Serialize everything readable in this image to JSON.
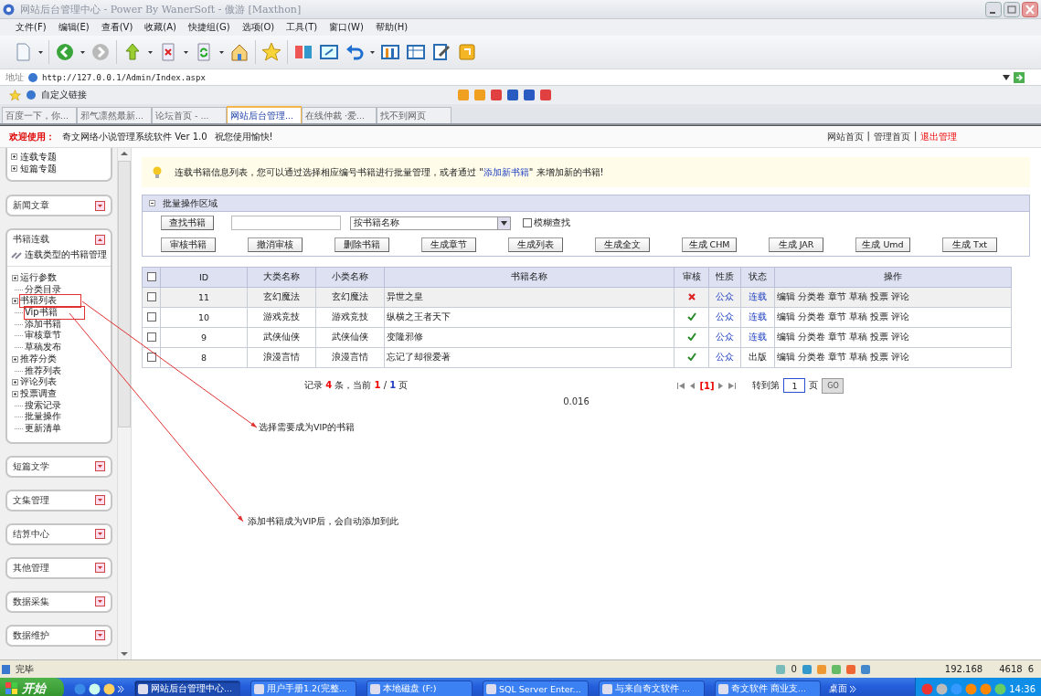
{
  "window": {
    "title": "网站后台管理中心 - Power By WanerSoft - 傲游 [Maxthon]"
  },
  "menu": [
    "文件(F)",
    "编辑(E)",
    "查看(V)",
    "收藏(A)",
    "快捷组(G)",
    "选项(O)",
    "工具(T)",
    "窗口(W)",
    "帮助(H)"
  ],
  "address_bar": {
    "label": "地址",
    "value": "http://127.0.0.1/Admin/Index.aspx"
  },
  "links_bar": {
    "items": [
      "自定义链接"
    ]
  },
  "browser_tabs": [
    {
      "label": "百度一下，你...",
      "selected": false
    },
    {
      "label": "邪气凛然最新...",
      "selected": false
    },
    {
      "label": "论坛首页 - ...",
      "selected": false
    },
    {
      "label": "网站后台管理...",
      "selected": true
    },
    {
      "label": "在线仲裁 ·爱...",
      "selected": false
    },
    {
      "label": "找不到网页",
      "selected": false
    }
  ],
  "app_header": {
    "welcome": "欢迎使用：",
    "product": "奇文网络小说管理系统软件  Ver 1.0",
    "greeting": "祝您使用愉快!",
    "separator": "|",
    "links": [
      {
        "label": "网站首页",
        "kind": "normal"
      },
      {
        "label": "管理首页",
        "kind": "normal"
      },
      {
        "label": "退出管理",
        "kind": "danger"
      }
    ]
  },
  "sidebar": {
    "top_items": [
      "连载专题",
      "短篇专题"
    ],
    "panels": [
      {
        "title": "新闻文章",
        "expanded": false
      },
      {
        "title": "书籍连载",
        "expanded": true,
        "subtitle": "连载类型的书籍管理",
        "items": [
          {
            "label": "运行参数",
            "kind": "folder",
            "highlighted": false
          },
          {
            "label": "分类目录",
            "kind": "leaf",
            "highlighted": false
          },
          {
            "label": "书籍列表",
            "kind": "folder",
            "highlighted": true
          },
          {
            "label": "Vip书籍",
            "kind": "leaf",
            "highlighted": true
          },
          {
            "label": "添加书籍",
            "kind": "leaf",
            "highlighted": false
          },
          {
            "label": "审核章节",
            "kind": "leaf",
            "highlighted": false
          },
          {
            "label": "草稿发布",
            "kind": "leaf",
            "highlighted": false
          },
          {
            "label": "推荐分类",
            "kind": "folder",
            "highlighted": false
          },
          {
            "label": "推荐列表",
            "kind": "leaf",
            "highlighted": false
          },
          {
            "label": "评论列表",
            "kind": "folder",
            "highlighted": false
          },
          {
            "label": "投票调查",
            "kind": "folder",
            "highlighted": false
          },
          {
            "label": "搜索记录",
            "kind": "leaf",
            "highlighted": false
          },
          {
            "label": "批量操作",
            "kind": "leaf",
            "highlighted": false
          },
          {
            "label": "更新清单",
            "kind": "leaf",
            "highlighted": false
          }
        ]
      },
      {
        "title": "短篇文学",
        "expanded": false
      },
      {
        "title": "文集管理",
        "expanded": false
      },
      {
        "title": "结算中心",
        "expanded": false
      },
      {
        "title": "其他管理",
        "expanded": false
      },
      {
        "title": "数据采集",
        "expanded": false
      },
      {
        "title": "数据维护",
        "expanded": false
      }
    ]
  },
  "notice": {
    "text": "连载书籍信息列表，您可以通过选择相应编号书籍进行批量管理，或者通过 \"",
    "link": "添加新书籍",
    "text_after": "\" 来增加新的书籍!"
  },
  "batch": {
    "title": "批量操作区域",
    "search_button": "查找书籍",
    "select_value": "按书籍名称",
    "fuzzy_checkbox": {
      "label": "模糊查找",
      "checked": false
    },
    "buttons": [
      "审核书籍",
      "撤消审核",
      "删除书籍",
      "生成章节",
      "生成列表",
      "生成全文",
      "生成 CHM",
      "生成 JAR",
      "生成 Umd",
      "生成 Txt"
    ]
  },
  "table": {
    "all_checked": false,
    "columns": [
      "ID",
      "大类名称",
      "小类名称",
      "书籍名称",
      "审核",
      "性质",
      "状态",
      "操作"
    ],
    "rows": [
      {
        "checked": false,
        "id": "11",
        "category": "玄幻魔法",
        "subcategory": "玄幻魔法",
        "name": "异世之皇",
        "approved": false,
        "nature": "公众",
        "status": "连载",
        "status_linked": true,
        "actions": [
          "编辑",
          "分类卷",
          "章节",
          "草稿",
          "投票",
          "评论"
        ]
      },
      {
        "checked": false,
        "id": "10",
        "category": "游戏竞技",
        "subcategory": "游戏竞技",
        "name": "纵横之王者天下",
        "approved": true,
        "nature": "公众",
        "status": "连载",
        "status_linked": true,
        "actions": [
          "编辑",
          "分类卷",
          "章节",
          "草稿",
          "投票",
          "评论"
        ]
      },
      {
        "checked": false,
        "id": "9",
        "category": "武侠仙侠",
        "subcategory": "武侠仙侠",
        "name": "变隆邪修",
        "approved": true,
        "nature": "公众",
        "status": "连载",
        "status_linked": true,
        "actions": [
          "编辑",
          "分类卷",
          "章节",
          "草稿",
          "投票",
          "评论"
        ]
      },
      {
        "checked": false,
        "id": "8",
        "category": "浪漫言情",
        "subcategory": "浪漫言情",
        "name": "忘记了却很爱著",
        "approved": true,
        "nature": "公众",
        "status": "出版",
        "status_linked": false,
        "actions": [
          "编辑",
          "分类卷",
          "章节",
          "草稿",
          "投票",
          "评论"
        ]
      }
    ]
  },
  "pager": {
    "summary": "记录 **4** 条，当前 **1** / *1* 页",
    "current_page": "[1]",
    "goto_label": "转到第",
    "goto_value": "1",
    "page_unit": "页",
    "go_button": "GO",
    "elapsed": "0.016"
  },
  "annotations": [
    {
      "text": "选择需要成为VIP的书籍"
    },
    {
      "text": "添加书籍成为VIP后，会自动添加到此"
    }
  ],
  "status_bar": {
    "text": "完毕",
    "readings": [
      "0",
      "192.168",
      "4618",
      "6"
    ]
  },
  "taskbar": {
    "start": "开始",
    "tasks": [
      {
        "label": "网站后台管理中心...",
        "selected": true
      },
      {
        "label": "用户手册1.2(完整...",
        "selected": false
      },
      {
        "label": "本地磁盘 (F:)",
        "selected": false
      },
      {
        "label": "SQL Server Enter...",
        "selected": false
      },
      {
        "label": "与来自奇文软件 ...",
        "selected": false
      },
      {
        "label": "奇文软件 商业支...",
        "selected": false
      }
    ],
    "desktop": "桌面",
    "clock": "14:36"
  }
}
